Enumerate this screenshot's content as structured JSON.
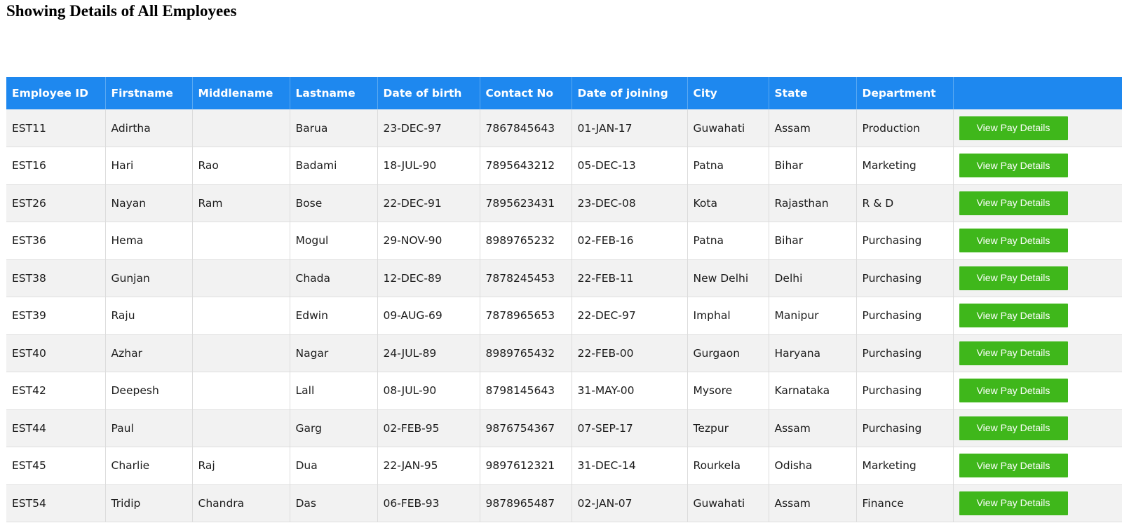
{
  "page": {
    "title": "Showing Details of All Employees"
  },
  "table": {
    "headers": [
      "Employee ID",
      "Firstname",
      "Middlename",
      "Lastname",
      "Date of birth",
      "Contact No",
      "Date of joining",
      "City",
      "State",
      "Department",
      ""
    ],
    "action_label": "View Pay Details",
    "colors": {
      "header_bg": "#1e88ef",
      "button_bg": "#3fb71b",
      "row_alt_bg": "#f2f2f2"
    },
    "rows": [
      [
        "EST11",
        "Adirtha",
        "",
        "Barua",
        "23-DEC-97",
        "7867845643",
        "01-JAN-17",
        "Guwahati",
        "Assam",
        "Production"
      ],
      [
        "EST16",
        "Hari",
        "Rao",
        "Badami",
        "18-JUL-90",
        "7895643212",
        "05-DEC-13",
        "Patna",
        "Bihar",
        "Marketing"
      ],
      [
        "EST26",
        "Nayan",
        "Ram",
        "Bose",
        "22-DEC-91",
        "7895623431",
        "23-DEC-08",
        "Kota",
        "Rajasthan",
        "R & D"
      ],
      [
        "EST36",
        "Hema",
        "",
        "Mogul",
        "29-NOV-90",
        "8989765232",
        "02-FEB-16",
        "Patna",
        "Bihar",
        "Purchasing"
      ],
      [
        "EST38",
        "Gunjan",
        "",
        "Chada",
        "12-DEC-89",
        "7878245453",
        "22-FEB-11",
        "New Delhi",
        "Delhi",
        "Purchasing"
      ],
      [
        "EST39",
        "Raju",
        "",
        "Edwin",
        "09-AUG-69",
        "7878965653",
        "22-DEC-97",
        "Imphal",
        "Manipur",
        "Purchasing"
      ],
      [
        "EST40",
        "Azhar",
        "",
        "Nagar",
        "24-JUL-89",
        "8989765432",
        "22-FEB-00",
        "Gurgaon",
        "Haryana",
        "Purchasing"
      ],
      [
        "EST42",
        "Deepesh",
        "",
        "Lall",
        "08-JUL-90",
        "8798145643",
        "31-MAY-00",
        "Mysore",
        "Karnataka",
        "Purchasing"
      ],
      [
        "EST44",
        "Paul",
        "",
        "Garg",
        "02-FEB-95",
        "9876754367",
        "07-SEP-17",
        "Tezpur",
        "Assam",
        "Purchasing"
      ],
      [
        "EST45",
        "Charlie",
        "Raj",
        "Dua",
        "22-JAN-95",
        "9897612321",
        "31-DEC-14",
        "Rourkela",
        "Odisha",
        "Marketing"
      ],
      [
        "EST54",
        "Tridip",
        "Chandra",
        "Das",
        "06-FEB-93",
        "9878965487",
        "02-JAN-07",
        "Guwahati",
        "Assam",
        "Finance"
      ]
    ]
  }
}
